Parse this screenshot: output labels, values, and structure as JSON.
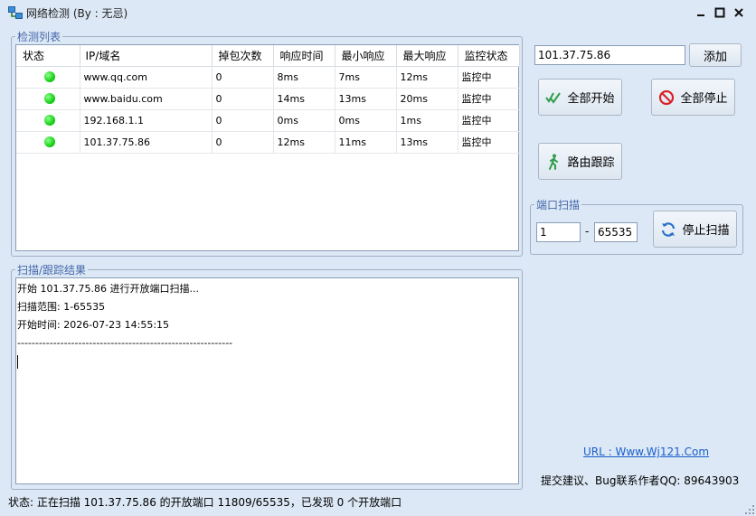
{
  "window": {
    "title": "网络检测 (By : 无忌)"
  },
  "list_panel": {
    "legend": "检测列表",
    "columns": [
      "状态",
      "IP/域名",
      "掉包次数",
      "响应时间",
      "最小响应",
      "最大响应",
      "监控状态"
    ],
    "rows": [
      {
        "status": "green",
        "host": "www.qq.com",
        "lost": "0",
        "resp": "8ms",
        "min": "7ms",
        "max": "12ms",
        "state": "监控中"
      },
      {
        "status": "green",
        "host": "www.baidu.com",
        "lost": "0",
        "resp": "14ms",
        "min": "13ms",
        "max": "20ms",
        "state": "监控中"
      },
      {
        "status": "green",
        "host": "192.168.1.1",
        "lost": "0",
        "resp": "0ms",
        "min": "0ms",
        "max": "1ms",
        "state": "监控中"
      },
      {
        "status": "green",
        "host": "101.37.75.86",
        "lost": "0",
        "resp": "12ms",
        "min": "11ms",
        "max": "13ms",
        "state": "监控中"
      }
    ]
  },
  "result_panel": {
    "legend": "扫描/跟踪结果",
    "lines": [
      "开始 101.37.75.86 进行开放端口扫描...",
      "扫描范围: 1-65535",
      "开始时间: 2026-07-23 14:55:15",
      "------------------------------------------------------------"
    ]
  },
  "controls": {
    "host_input_value": "101.37.75.86",
    "add_label": "添加",
    "start_all_label": "全部开始",
    "stop_all_label": "全部停止",
    "trace_label": "路由跟踪"
  },
  "port_scan": {
    "legend": "端口扫描",
    "from_value": "1",
    "dash": "-",
    "to_value": "65535",
    "stop_label": "停止扫描"
  },
  "footer": {
    "url": "URL : Www.Wj121.Com",
    "contact": "提交建议、Bug联系作者QQ: 89643903"
  },
  "statusbar": {
    "text": "状态: 正在扫描 101.37.75.86 的开放端口 11809/65535，已发现 0 个开放端口"
  },
  "colors": {
    "window_bg": "#dce8f5",
    "status_ok": "#18d018",
    "link": "#1a5fcc",
    "legend": "#4466aa"
  }
}
